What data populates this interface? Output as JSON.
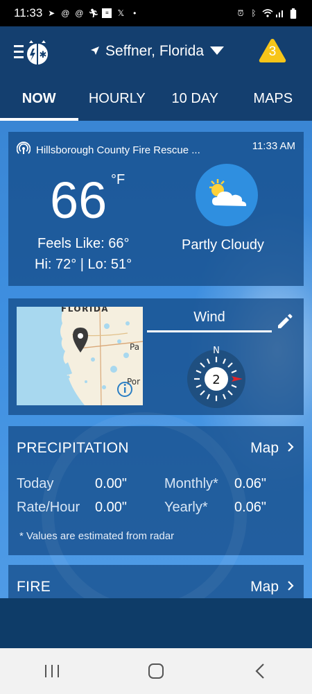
{
  "status_bar": {
    "time": "11:33",
    "left_icons": [
      "telegram-icon",
      "threads-icon",
      "threads-icon",
      "running-icon",
      "news-icon",
      "x-icon",
      "dot-icon"
    ],
    "right_icons": [
      "alarm-icon",
      "bluetooth-icon",
      "wifi-icon",
      "signal-icon",
      "battery-icon"
    ]
  },
  "header": {
    "location": "Seffner, Florida",
    "alert_count": "3"
  },
  "tabs": [
    {
      "label": "NOW",
      "active": true
    },
    {
      "label": "HOURLY",
      "active": false
    },
    {
      "label": "10 DAY",
      "active": false
    },
    {
      "label": "MAPS",
      "active": false
    }
  ],
  "current": {
    "station": "Hillsborough County Fire Rescue ...",
    "time": "11:33 AM",
    "temperature": "66",
    "unit": "°F",
    "feels_like": "Feels Like: 66°",
    "hi_lo": "Hi: 72° | Lo: 51°",
    "condition": "Partly Cloudy",
    "condition_icon": "partly-cloudy-icon"
  },
  "map_wind": {
    "map_labels": {
      "state": "FLORIDA",
      "place1": "Pa",
      "place2": "Por"
    },
    "wind_title": "Wind",
    "wind_speed": "2",
    "wind_direction_label": "N"
  },
  "precipitation": {
    "title": "PRECIPITATION",
    "map_label": "Map",
    "rows": [
      {
        "label": "Today",
        "value": "0.00\"",
        "label2": "Monthly*",
        "value2": "0.06\""
      },
      {
        "label": "Rate/Hour",
        "value": "0.00\"",
        "label2": "Yearly*",
        "value2": "0.06\""
      }
    ],
    "footnote": "* Values are estimated from radar"
  },
  "fire": {
    "title": "FIRE",
    "map_label": "Map"
  },
  "colors": {
    "header_bg": "#143f6f",
    "content_bg": "#3e8fe0",
    "alert_yellow": "#f7c519",
    "wind_arrow": "#e0242a"
  }
}
